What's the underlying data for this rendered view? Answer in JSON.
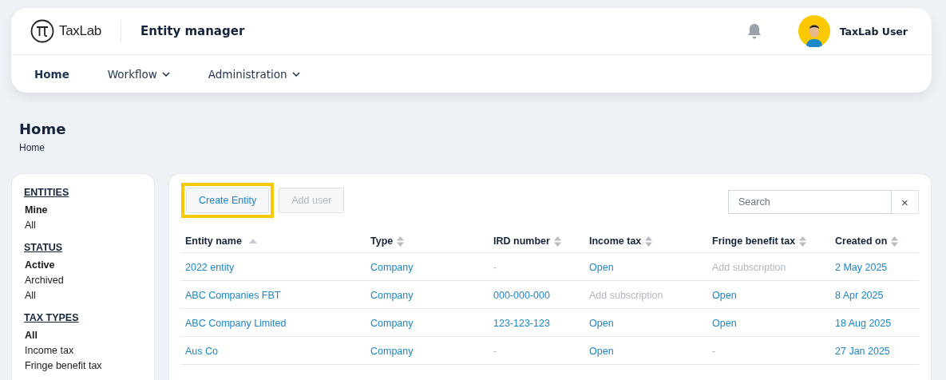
{
  "header": {
    "brand": "TaxLab",
    "app_title": "Entity manager",
    "user_name": "TaxLab User"
  },
  "nav": [
    {
      "label": "Home",
      "selected": true,
      "has_menu": false
    },
    {
      "label": "Workflow",
      "selected": false,
      "has_menu": true
    },
    {
      "label": "Administration",
      "selected": false,
      "has_menu": true
    }
  ],
  "page": {
    "title": "Home",
    "breadcrumb": "Home"
  },
  "sidebar": [
    {
      "heading": "ENTITIES",
      "items": [
        {
          "label": "Mine",
          "selected": true
        },
        {
          "label": "All",
          "selected": false
        }
      ]
    },
    {
      "heading": "STATUS",
      "items": [
        {
          "label": "Active",
          "selected": true
        },
        {
          "label": "Archived",
          "selected": false
        },
        {
          "label": "All",
          "selected": false
        }
      ]
    },
    {
      "heading": "TAX TYPES",
      "items": [
        {
          "label": "All",
          "selected": true
        },
        {
          "label": "Income tax",
          "selected": false
        },
        {
          "label": "Fringe benefit tax",
          "selected": false
        }
      ]
    }
  ],
  "toolbar": {
    "buttons": [
      {
        "label": "Create Entity",
        "disabled": false,
        "highlighted": true
      },
      {
        "label": "Add user",
        "disabled": true,
        "highlighted": false
      }
    ],
    "search": {
      "placeholder": "Search",
      "clear": "×"
    }
  },
  "table": {
    "columns": [
      {
        "label": "Entity name",
        "sorted": true
      },
      {
        "label": "Type",
        "sorted": false
      },
      {
        "label": "IRD number",
        "sorted": false
      },
      {
        "label": "Income tax",
        "sorted": false
      },
      {
        "label": "Fringe benefit tax",
        "sorted": false
      },
      {
        "label": "Created on",
        "sorted": false
      }
    ],
    "rows": [
      [
        {
          "text": "2022 entity",
          "kind": "link"
        },
        {
          "text": "Company",
          "kind": "link"
        },
        {
          "text": "-",
          "kind": "muted"
        },
        {
          "text": "Open",
          "kind": "link"
        },
        {
          "text": "Add subscription",
          "kind": "muted"
        },
        {
          "text": "2 May 2025",
          "kind": "link"
        }
      ],
      [
        {
          "text": "ABC Companies FBT",
          "kind": "link"
        },
        {
          "text": "Company",
          "kind": "link"
        },
        {
          "text": "000-000-000",
          "kind": "link"
        },
        {
          "text": "Add subscription",
          "kind": "muted"
        },
        {
          "text": "Open",
          "kind": "link"
        },
        {
          "text": "8 Apr 2025",
          "kind": "link"
        }
      ],
      [
        {
          "text": "ABC Company Limited",
          "kind": "link"
        },
        {
          "text": "Company",
          "kind": "link"
        },
        {
          "text": "123-123-123",
          "kind": "link"
        },
        {
          "text": "Open",
          "kind": "link"
        },
        {
          "text": "Open",
          "kind": "link"
        },
        {
          "text": "18 Aug 2025",
          "kind": "link"
        }
      ],
      [
        {
          "text": "Aus Co",
          "kind": "link"
        },
        {
          "text": "Company",
          "kind": "link"
        },
        {
          "text": "-",
          "kind": "muted"
        },
        {
          "text": "Open",
          "kind": "link"
        },
        {
          "text": "-",
          "kind": "muted"
        },
        {
          "text": "27 Jan 2025",
          "kind": "link"
        }
      ]
    ]
  }
}
